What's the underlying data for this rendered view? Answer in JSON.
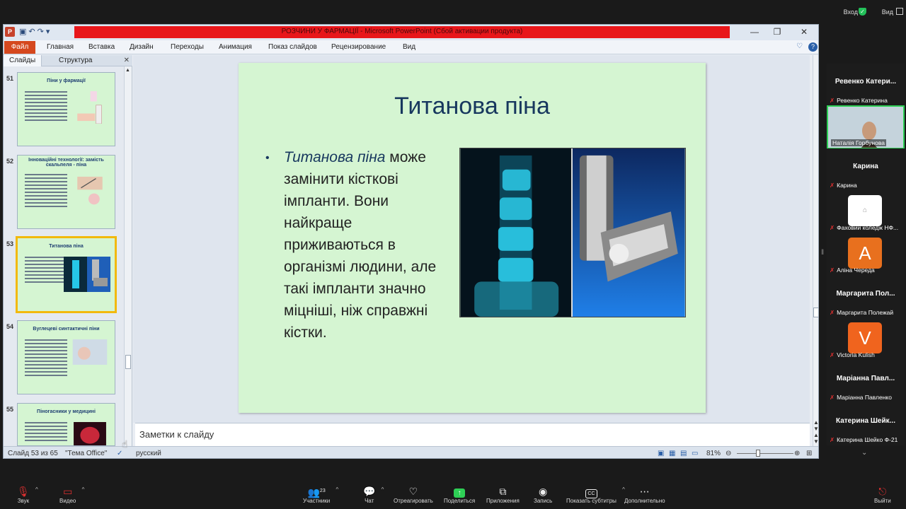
{
  "zoom_top": {
    "enter": "Вход",
    "view": "Вид"
  },
  "ppt": {
    "title": "РОЗЧИНИ У ФАРМАЦІЇ  -  Microsoft PowerPoint (Сбой активации продукта)",
    "file_tab": "Файл",
    "tabs": [
      "Главная",
      "Вставка",
      "Дизайн",
      "Переходы",
      "Анимация",
      "Показ слайдов",
      "Рецензирование",
      "Вид"
    ],
    "panel_tabs": [
      "Слайды",
      "Структура"
    ],
    "thumbnails": [
      {
        "num": "51",
        "title": "Піни у фармації"
      },
      {
        "num": "52",
        "title": "Інноваційні технології: замість скальпеля - піна"
      },
      {
        "num": "53",
        "title": "Титанова піна"
      },
      {
        "num": "54",
        "title": "Вуглецеві синтактичні піни"
      },
      {
        "num": "55",
        "title": "Піногасники у медицині"
      }
    ],
    "slide": {
      "title": "Титанова піна",
      "bullet_italic": "Титанова піна",
      "bullet_rest": "може замінити кісткові імпланти. Вони найкраще приживаються в організмі людини, але такі імпланти значно міцніші, ніж справжні кістки."
    },
    "notes_placeholder": "Заметки к слайду",
    "status": {
      "slide": "Слайд 53 из 65",
      "theme": "\"Тема Office\"",
      "lang": "русский",
      "zoom": "81%"
    }
  },
  "participants": [
    {
      "big": "Ревенко  Катери...",
      "small": "Ревенко Катерина",
      "kind": "name"
    },
    {
      "small": "Наталія Горбунова",
      "kind": "video"
    },
    {
      "big": "Карина",
      "small": "Карина",
      "kind": "name"
    },
    {
      "small": "Фаховий коледж НФ...",
      "kind": "image"
    },
    {
      "letter": "A",
      "small": "Аліна Череда",
      "kind": "avatar",
      "color": "#e8701e"
    },
    {
      "big": "Маргарита  Пол...",
      "small": "Маргарита Полежай",
      "kind": "name"
    },
    {
      "letter": "V",
      "small": "Victoria Kulish",
      "kind": "avatar",
      "color": "#f0641e"
    },
    {
      "big": "Маріанна  Павл...",
      "small": "Маріанна Павленко",
      "kind": "name"
    },
    {
      "big": "Катерина  Шейк...",
      "small": "Катерина Шейко Ф-21",
      "kind": "name"
    }
  ],
  "toolbar": {
    "audio": "Звук",
    "video": "Видео",
    "participants": "Участники",
    "participants_count": "23",
    "chat": "Чат",
    "react": "Отреагировать",
    "share": "Поделиться",
    "apps": "Приложения",
    "record": "Запись",
    "captions": "Показать субтитры",
    "more": "Дополнительно",
    "leave": "Выйти"
  }
}
